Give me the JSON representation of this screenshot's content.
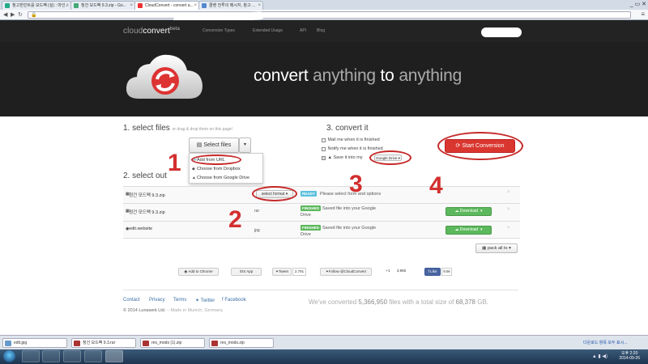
{
  "browser": {
    "tabs": [
      {
        "title": "청고한민트를 모드팩 (실) : 마인...",
        "fav_color": "#2a8"
      },
      {
        "title": "청건 모드팩 9.3.zip - Go...",
        "fav_color": "#4a7"
      },
      {
        "title": "CloudConvert - convert a...",
        "fav_color": "#e33"
      },
      {
        "title": "클랜 전투의 메시지, 참고 ...",
        "fav_color": "#58c"
      }
    ],
    "window_controls": "_ ▭ ✕",
    "lock_icon": "lock-icon",
    "url": ""
  },
  "nav": {
    "logo_prefix": "cloud",
    "logo_main": "convert",
    "logo_sup": "beta",
    "links": [
      "Conversion Types",
      "Extended Usage",
      "API",
      "Blog"
    ]
  },
  "hero": {
    "word1": "convert",
    "word2": "anything",
    "word3": "to",
    "word4": "anything"
  },
  "step1": {
    "title": "1. select files",
    "hint": "or drag & drop them on this page!",
    "button_label": "Select files",
    "caret": "▾",
    "dropdown": [
      "Add from URL",
      "Choose from Dropbox",
      "Choose from Google Drive"
    ]
  },
  "step2": {
    "title": "2. select output format",
    "title_visible": "2. select out",
    "files": [
      {
        "name": "청건 모드팩 9.3.zip",
        "format": "select format ▾",
        "badge": "READY",
        "status_1": "Please select form",
        "status_2": "and options",
        "action": "",
        "badge_color": "#5bc0de"
      },
      {
        "name": "청건 모드팩 9.3.zip",
        "format": "rar",
        "badge": "FINISHED",
        "status_1": "Saved file into your Google",
        "status_2": "Drive",
        "action": "Download",
        "badge_color": "#5cb85c"
      },
      {
        "name": "edit.website",
        "format": "jpg",
        "badge": "FINISHED",
        "status_1": "Saved file into your Google",
        "status_2": "Drive",
        "action": "Download",
        "badge_color": "#5cb85c"
      }
    ],
    "pack_all": "pack all to ▾",
    "remove_symbol": "×"
  },
  "step3": {
    "title": "3. convert it",
    "options": [
      "Mail me when it is finished",
      "Notify me when it is finished",
      "Save it into my"
    ],
    "storage": "Google Drive ▾",
    "start_button": "Start Conversion"
  },
  "social": {
    "chrome": "Add to Chrome",
    "ios": "iOS App",
    "tweet": "Tweet",
    "tweet_count": "2,791",
    "follow": "Follow @CloudConvert",
    "gplus": "+1",
    "gplus_count": "3,955",
    "like": "Like",
    "like_count": "9.5k"
  },
  "footer": {
    "links": [
      "Contact",
      "Privacy",
      "Terms",
      "Twitter",
      "Facebook"
    ],
    "copyright": "© 2014 Lunaweb Ltd.",
    "made_in": "– Made in Munich, Germany",
    "stats_prefix": "We've converted",
    "files_count": "5,366,950",
    "stats_mid": "files with a total size of",
    "size": "68,378",
    "size_unit": "GB."
  },
  "downloads": {
    "items": [
      {
        "name": "edit.jpg",
        "color": "#69c"
      },
      {
        "name": "청건 모드팩 9.3.rar",
        "color": "#a33"
      },
      {
        "name": "res_mods (1).zip",
        "color": "#a33"
      },
      {
        "name": "res_mods.zip",
        "color": "#a33"
      }
    ],
    "show_all": "다운로드 항목 모두 표시..."
  },
  "taskbar": {
    "clock_time": "오후 2:20",
    "clock_date": "2014-09-26"
  },
  "annotations": [
    "1",
    "2",
    "3",
    "4"
  ],
  "colors": {
    "accent_red": "#d9362f",
    "annotation_red": "#d32f2f",
    "download_green": "#5cb85c"
  }
}
